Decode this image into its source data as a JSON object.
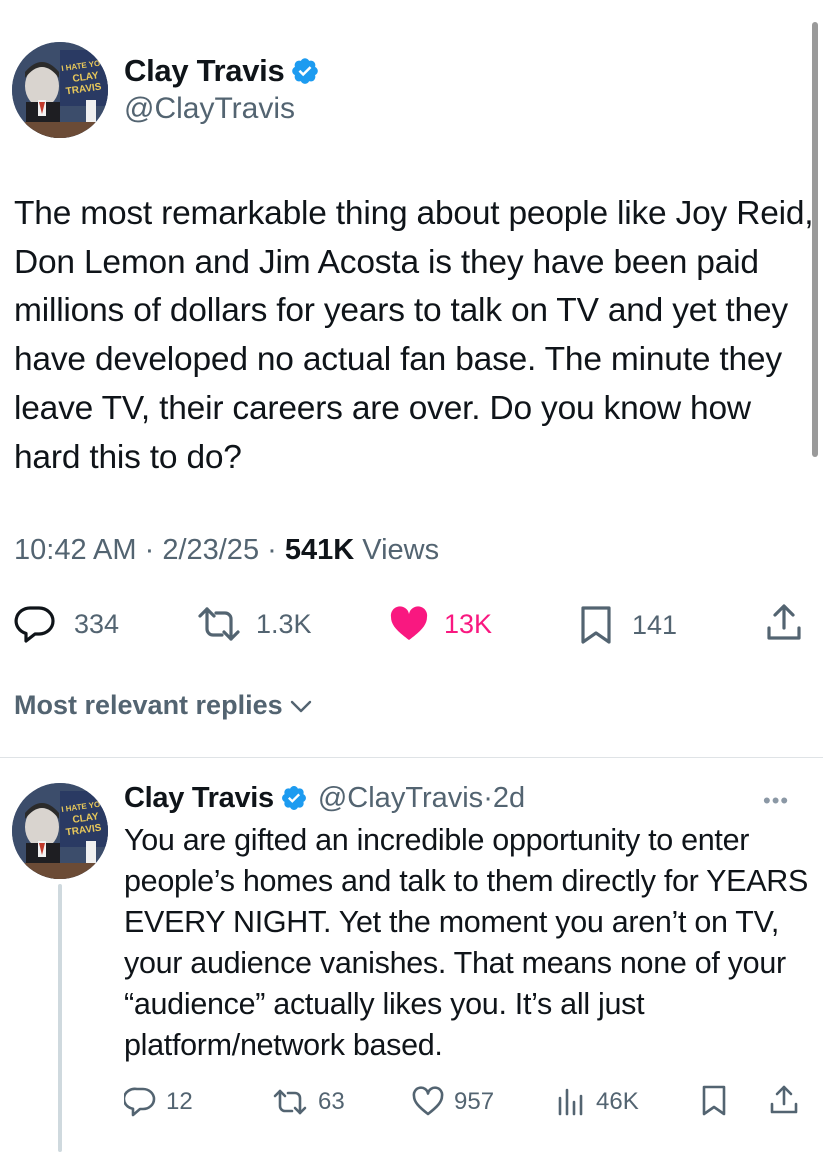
{
  "main_tweet": {
    "author_name": "Clay Travis",
    "author_handle": "@ClayTravis",
    "text": "The most remarkable thing about people like Joy Reid, Don Lemon and Jim Acosta is they have been paid millions of dollars for years to talk on TV and yet they have developed no actual fan base. The minute they leave TV, their careers are over. Do you know how hard this to do?",
    "time": "10:42 AM",
    "date": "2/23/25",
    "views_count": "541K",
    "views_label": "Views",
    "replies": "334",
    "reposts": "1.3K",
    "likes": "13K",
    "bookmarks": "141"
  },
  "avatar_banner_text": "I HATE YOU CLAY TRAVIS",
  "replies_sort_label": "Most relevant replies",
  "reply": {
    "author_name": "Clay Travis",
    "author_handle": "@ClayTravis",
    "time_ago": "2d",
    "text": "You are gifted an incredible opportunity to enter people’s homes and talk to them directly for YEARS EVERY NIGHT. Yet the moment you aren’t on TV, your audience vanishes. That means none of your “audience” actually likes you. It’s all just platform/network based.",
    "replies": "12",
    "reposts": "63",
    "likes": "957",
    "views": "46K"
  },
  "colors": {
    "accent_blue": "#1d9bf0",
    "like_pink": "#f91880",
    "muted_gray": "#536471"
  },
  "icons": [
    "verified-badge-icon",
    "reply-icon",
    "repost-icon",
    "like-icon",
    "bookmark-icon",
    "share-icon",
    "views-icon",
    "chevron-down-icon",
    "more-icon"
  ]
}
